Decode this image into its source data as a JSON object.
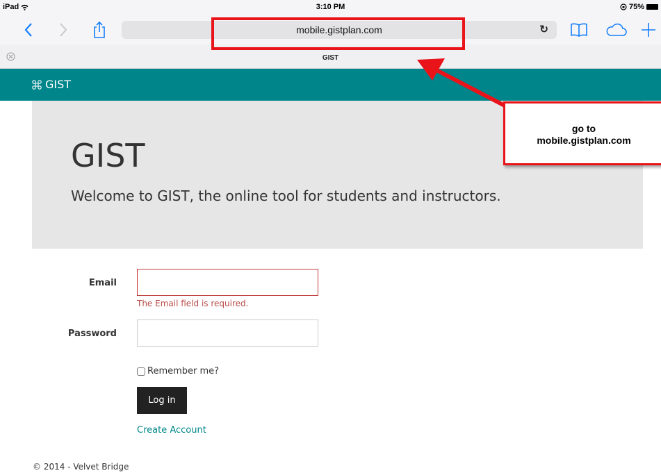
{
  "status_bar": {
    "device": "iPad",
    "time": "3:10 PM",
    "battery": "75%"
  },
  "browser": {
    "url": "mobile.gistplan.com",
    "tab_title": "GIST",
    "icons": [
      "back-chevron-icon",
      "forward-chevron-icon",
      "share-icon",
      "reload-icon",
      "bookmarks-icon",
      "icloud-tabs-icon",
      "new-tab-icon",
      "close-tab-icon"
    ]
  },
  "site": {
    "brand": "GIST",
    "hero": {
      "title": "GIST",
      "subtitle": "Welcome to GIST, the online tool for students and instructors."
    },
    "form": {
      "email_label": "Email",
      "email_value": "",
      "email_error": "The Email field is required.",
      "password_label": "Password",
      "password_value": "",
      "remember_label": "Remember me?",
      "remember_checked": false,
      "login_label": "Log in",
      "create_account_label": "Create Account"
    },
    "footer": "© 2014 - Velvet Bridge"
  },
  "annotation": {
    "callout_line1": "go to",
    "callout_line2": "mobile.gistplan.com",
    "color": "#e8141a"
  },
  "colors": {
    "nav": "#00868a",
    "hero_bg": "#e6e6e6",
    "error": "#b94a48",
    "button": "#222222"
  }
}
